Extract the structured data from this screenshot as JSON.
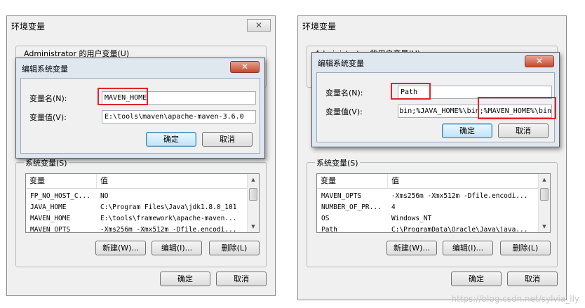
{
  "left": {
    "window_title": "环境变量",
    "user_section": "Administrator 的用户变量(U)",
    "system_section": "系统变量(S)",
    "ok": "确定",
    "cancel": "取消",
    "dialog": {
      "title": "编辑系统变量",
      "close_glyph": "✕",
      "name_label": "变量名(N):",
      "value_label": "变量值(V):",
      "name_value": "MAVEN_HOME",
      "value_value": "E:\\tools\\maven\\apache-maven-3.6.0",
      "ok": "确定",
      "cancel": "取消"
    },
    "table": {
      "columns": [
        "变量",
        "值"
      ],
      "rows": [
        {
          "name": "FP_NO_HOST_C...",
          "value": "NO"
        },
        {
          "name": "JAVA_HOME",
          "value": "C:\\Program Files\\Java\\jdk1.8.0_101"
        },
        {
          "name": "MAVEN_HOME",
          "value": "E:\\tools\\framework\\apache-maven..."
        },
        {
          "name": "MAVEN_OPTS",
          "value": "-Xms256m -Xmx512m -Dfile.encodi..."
        }
      ]
    },
    "buttons": {
      "new": "新建(W)...",
      "edit": "编辑(I)...",
      "delete": "删除(L)"
    }
  },
  "right": {
    "window_title": "环境变量",
    "user_section": "Administrator 的用户变量(U)",
    "system_section": "系统变量(S)",
    "ok": "确定",
    "cancel": "取消",
    "dialog": {
      "title": "编辑系统变量",
      "close_glyph": "✕",
      "name_label": "变量名(N):",
      "value_label": "变量值(V):",
      "name_value": "Path",
      "value_value": "bin;%JAVA_HOME%\\bin;%MAVEN_HOME%\\bin",
      "ok": "确定",
      "cancel": "取消"
    },
    "table": {
      "columns": [
        "变量",
        "值"
      ],
      "rows": [
        {
          "name": "MAVEN_OPTS",
          "value": "-Xms256m -Xmx512m -Dfile.encodi..."
        },
        {
          "name": "NUMBER_OF_PR...",
          "value": "4"
        },
        {
          "name": "OS",
          "value": "Windows_NT"
        },
        {
          "name": "Path",
          "value": "C:\\ProgramData\\Oracle\\Java\\java..."
        }
      ]
    },
    "buttons": {
      "new": "新建(W)...",
      "edit": "编辑(I)...",
      "delete": "删除(L)"
    }
  },
  "watermark": "https://blog.csdn.net/sylvia_lly",
  "colors": {
    "highlight": "#e3242b",
    "dialog_frame": "#dfe7f1",
    "window_bg": "#f0f0f0"
  }
}
